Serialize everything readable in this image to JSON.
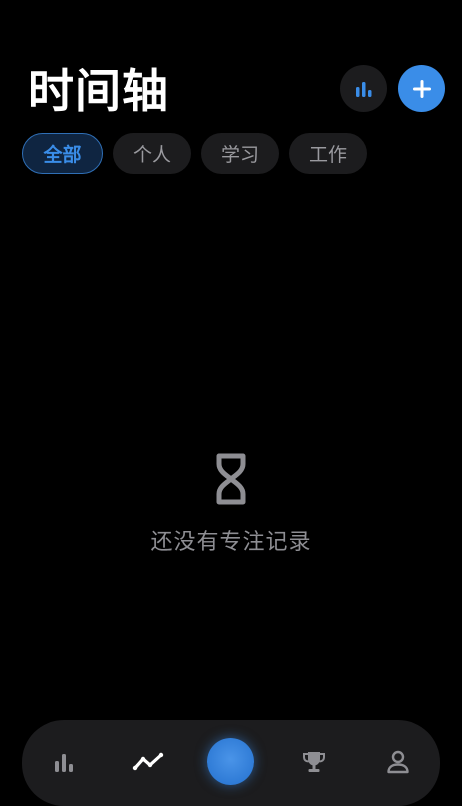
{
  "header": {
    "title": "时间轴"
  },
  "filters": [
    {
      "label": "全部",
      "active": true
    },
    {
      "label": "个人",
      "active": false
    },
    {
      "label": "学习",
      "active": false
    },
    {
      "label": "工作",
      "active": false
    }
  ],
  "empty_state": {
    "icon": "hourglass-icon",
    "message": "还没有专注记录"
  },
  "tabbar": {
    "items": [
      {
        "icon": "bar-chart-icon",
        "active": false
      },
      {
        "icon": "trend-line-icon",
        "active": true
      },
      {
        "icon": "focus-start-button",
        "active": false
      },
      {
        "icon": "trophy-icon",
        "active": false
      },
      {
        "icon": "profile-icon",
        "active": false
      }
    ]
  },
  "colors": {
    "background": "#000000",
    "accent": "#3a8de8",
    "surface": "#1c1c1e",
    "muted_text": "#8e8e93"
  }
}
